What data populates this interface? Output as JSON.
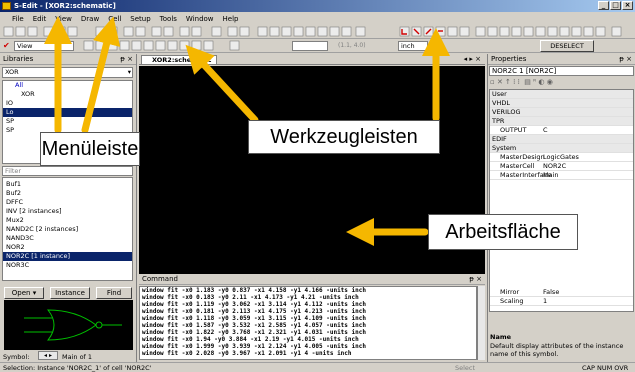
{
  "window": {
    "title": "S-Edit - [XOR2:schematic]",
    "controls": [
      "_",
      "□",
      "×"
    ]
  },
  "menu": [
    "File",
    "Edit",
    "View",
    "Draw",
    "Cell",
    "Setup",
    "Tools",
    "Window",
    "Help"
  ],
  "toolbar2": {
    "view_label": "View",
    "zoom_value": "(1.1, 4.0)",
    "unit_value": "inch",
    "deselect_label": "DESELECT"
  },
  "libraries": {
    "title": "Libraries",
    "library_select": "XOR",
    "library_tree": [
      "All",
      "XOR",
      "IO",
      "Lo",
      "SP",
      "SP"
    ],
    "filter_label": "Filter",
    "cells": [
      "Buf1",
      "Buf2",
      "DFFC",
      "INV [2 instances]",
      "Mux2",
      "NAND2C [2 instances]",
      "NAND3C",
      "NOR2",
      "NOR2C [1 instance]",
      "NOR3C"
    ],
    "selected_cell_index": 8,
    "open_label": "Open",
    "instance_label": "Instance",
    "find_label": "Find",
    "symbol_label": "Symbol:",
    "pagination": "Main of 1"
  },
  "canvas": {
    "tab_label": "XOR2:schematic"
  },
  "command": {
    "title": "Command",
    "lines": [
      "window fit -x0 1.183 -y0 0.837 -x1 4.158 -y1 4.166 -units inch",
      "window fit -x0 0.183 -y0 2.11 -x1 4.173 -y1 4.21 -units inch",
      "window fit -x0 1.119 -y0 3.062 -x1 3.114 -y1 4.112 -units inch",
      "window fit -x0 0.181 -y0 2.113 -x1 4.175 -y1 4.213 -units inch",
      "window fit -x0 1.118 -y0 3.059 -x1 3.115 -y1 4.109 -units inch",
      "window fit -x0 1.587 -y0 3.532 -x1 2.585 -y1 4.057 -units inch",
      "window fit -x0 1.822 -y0 3.768 -x1 2.321 -y1 4.031 -units inch",
      "window fit -x0 1.94 -y0 3.884 -x1 2.19 -y1 4.015 -units inch",
      "window fit -x0 1.999 -y0 3.939 -x1 2.124 -y1 4.005 -units inch",
      "window fit -x0 2.028 -y0 3.967 -x1 2.091 -y1 4 -units inch"
    ]
  },
  "properties": {
    "title": "Properties",
    "header": "NOR2C 1 [NOR2C]",
    "rows": [
      {
        "group": true,
        "key": "User"
      },
      {
        "group": true,
        "key": "VHDL"
      },
      {
        "group": true,
        "key": "VERILOG"
      },
      {
        "group": true,
        "key": "TPR"
      },
      {
        "group": false,
        "key": "OUTPUT",
        "value": "C"
      },
      {
        "group": true,
        "key": "EDIF"
      },
      {
        "group": true,
        "key": "System"
      },
      {
        "group": false,
        "key": "MasterDesign",
        "value": "LogicGates"
      },
      {
        "group": false,
        "key": "MasterCell",
        "value": "NOR2C"
      },
      {
        "group": false,
        "key": "MasterInterface",
        "value": "Main"
      },
      {
        "group": false,
        "key": "Mirror",
        "value": "False"
      },
      {
        "group": false,
        "key": "Scaling",
        "value": "1"
      }
    ],
    "desc_title": "Name",
    "desc_text": "Default display attributes of the instance name of this symbol."
  },
  "statusbar": {
    "text": "Selection: Instance 'NOR2C_1' of cell 'NOR2C'",
    "right": "Select",
    "indicators": "CAP NUM OVR"
  },
  "callouts": {
    "menu": "Menüleiste",
    "toolbars": "Werkzeugleisten",
    "workspace": "Arbeitsfläche"
  },
  "colors": {
    "callout_arrow": "#f5b700",
    "canvas_bg": "#000000",
    "title_bg": "#0a246a",
    "selection": "#0a246a",
    "schematic_green": "#00c000"
  }
}
